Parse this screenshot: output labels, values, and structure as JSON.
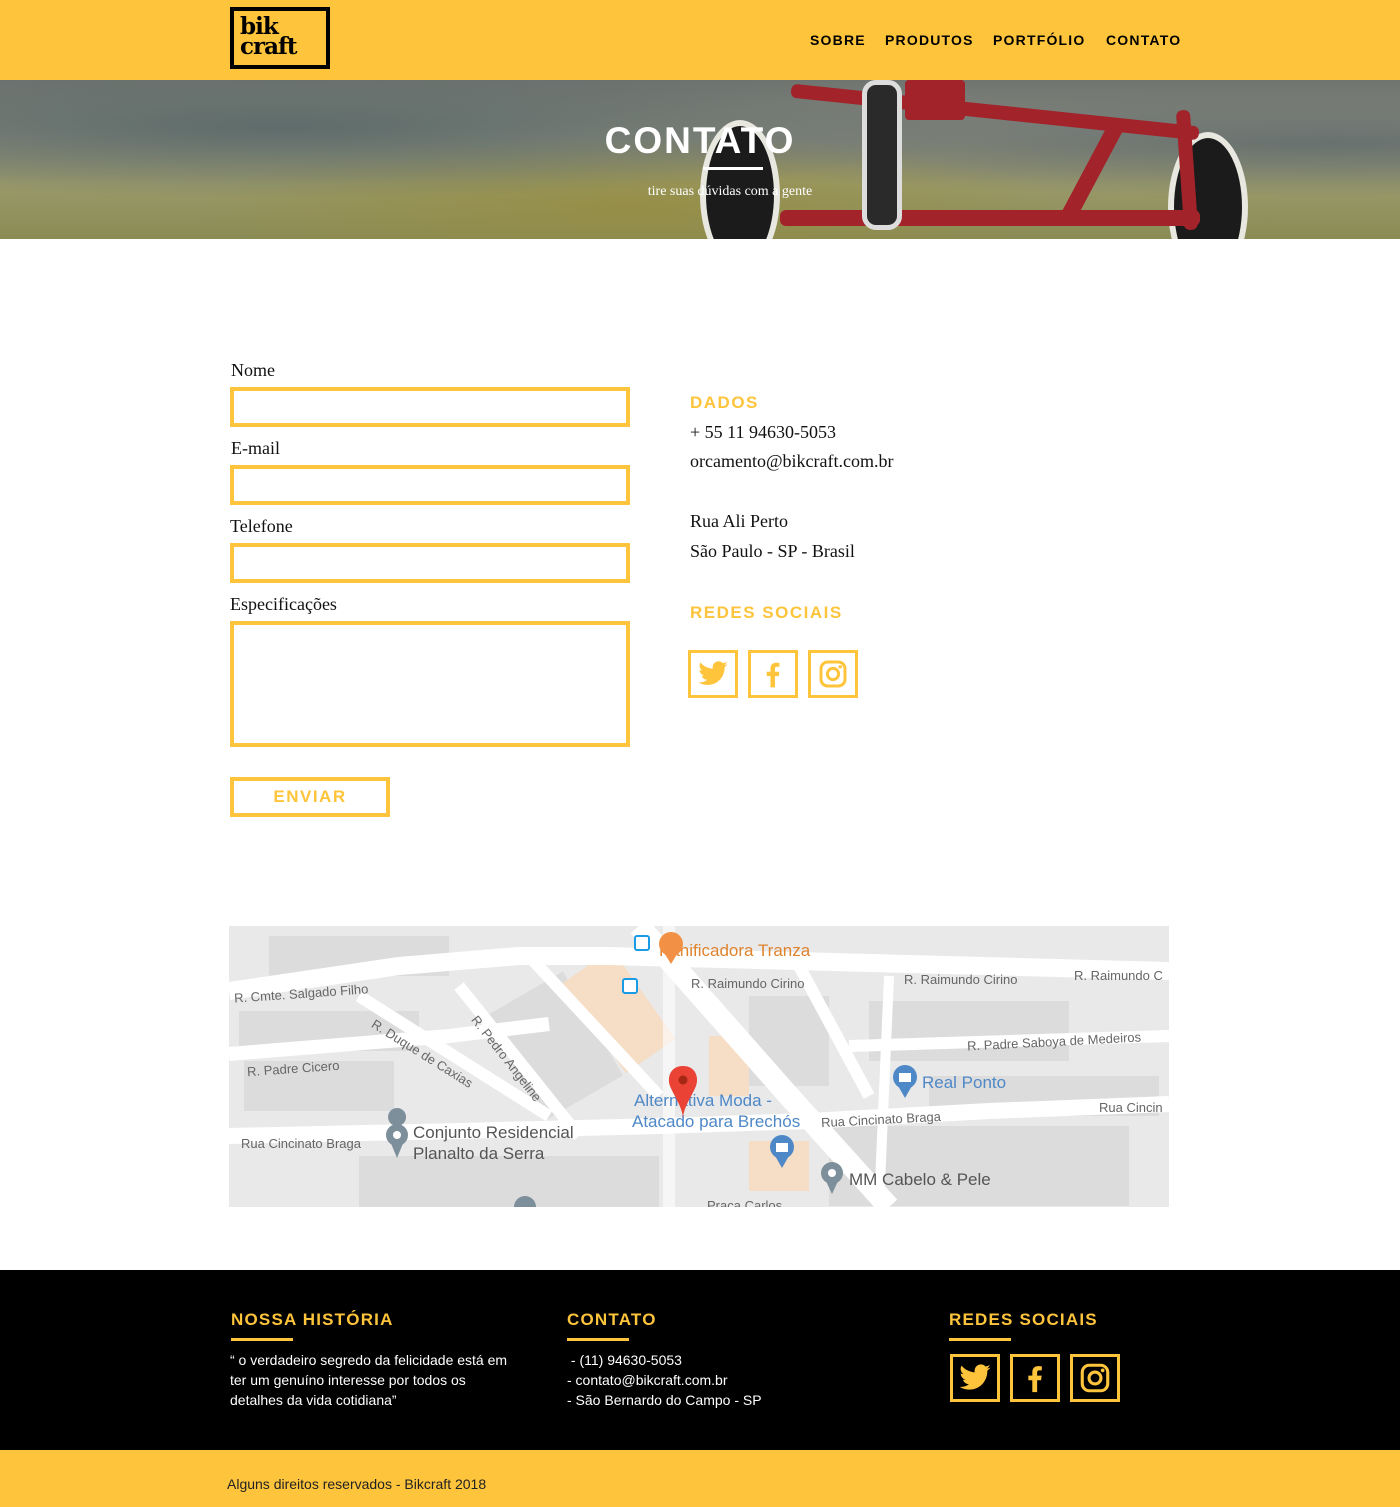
{
  "header": {
    "logo_line1": "bik",
    "logo_line2": "craft",
    "nav": [
      "SOBRE",
      "PRODUTOS",
      "PORTFÓLIO",
      "CONTATO"
    ]
  },
  "hero": {
    "title": "CONTATO",
    "subtitle": "tire suas dúvidas com a gente"
  },
  "form": {
    "name_label": "Nome",
    "email_label": "E-mail",
    "phone_label": "Telefone",
    "spec_label": "Especificações",
    "submit_label": "ENVIAR"
  },
  "contact_data": {
    "heading": "DADOS",
    "phone": "+ 55 11 94630-5053",
    "email": "orcamento@bikcraft.com.br",
    "address_line1": "Rua Ali Perto",
    "address_line2": "São Paulo - SP - Brasil",
    "social_heading": "REDES SOCIAIS",
    "social_icons": [
      "twitter-icon",
      "facebook-icon",
      "instagram-icon"
    ]
  },
  "map": {
    "places": {
      "panificadora": "Panificadora Tranza",
      "alternativa_1": "Alternativa Moda -",
      "alternativa_2": "Atacado para Brechós",
      "real_ponto": "Real Ponto",
      "conjunto_1": "Conjunto Residencial",
      "conjunto_2": "Planalto da Serra",
      "mm": "MM Cabelo & Pele"
    },
    "streets": {
      "salgado": "R. Cmte. Salgado Filho",
      "raimundo1": "R. Raimundo Cirino",
      "raimundo2": "R. Raimundo Cirino",
      "raimundo3": "R. Raimundo C",
      "duque": "R. Duque de Caxias",
      "pedro": "R. Pedro Angeline",
      "padre_cicero": "R. Padre Cicero",
      "saboya": "R. Padre Saboya de Medeiros",
      "cincinato1": "Rua Cincinato Braga",
      "cincinato2": "Rua Cincinato Braga",
      "cincinato3": "Rua Cincin",
      "praca": "Praça Carlos"
    }
  },
  "footer": {
    "history_heading": "NOSSA HISTÓRIA",
    "history_line1": "“ o verdadeiro segredo da felicidade está  em",
    "history_line2": "ter um genuíno interesse por todos os",
    "history_line3": "detalhes da vida cotidiana”",
    "contact_heading": "CONTATO",
    "contact_phone": " - (11) 94630-5053",
    "contact_email": "- contato@bikcraft.com.br",
    "contact_city": "- São Bernardo do Campo - SP",
    "social_heading": "REDES SOCIAIS",
    "copyright": "Alguns direitos reservados - Bikcraft 2018"
  },
  "colors": {
    "brand_yellow": "#FEC43B",
    "black": "#000000",
    "map_pin_red": "#EA4335"
  }
}
